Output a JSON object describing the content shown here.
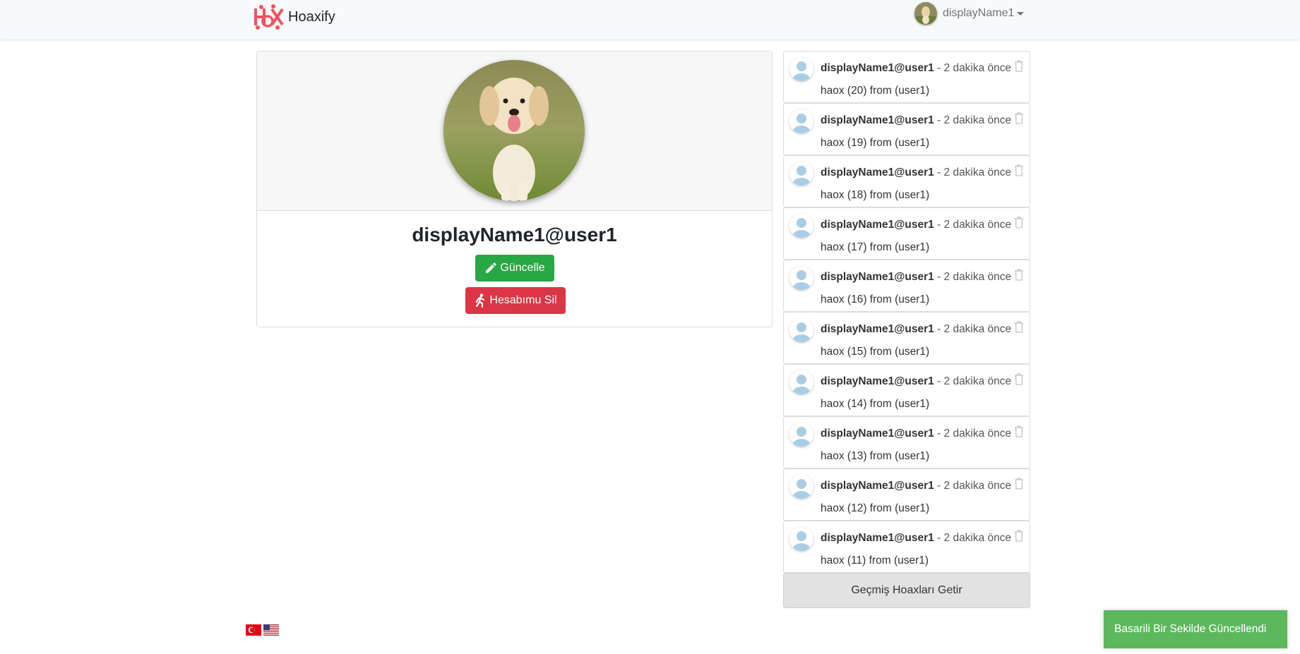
{
  "navbar": {
    "brand": "Hoaxify",
    "user_display_name": "displayName1"
  },
  "profile": {
    "title": "displayName1@user1",
    "update_label": "Güncelle",
    "delete_label": "Hesabımu Sil"
  },
  "hoaxes": [
    {
      "user": "displayName1@user1",
      "separator": " - ",
      "time": "2 dakika önce",
      "content": "haox (20) from (user1)"
    },
    {
      "user": "displayName1@user1",
      "separator": " - ",
      "time": "2 dakika önce",
      "content": "haox (19) from (user1)"
    },
    {
      "user": "displayName1@user1",
      "separator": " - ",
      "time": "2 dakika önce",
      "content": "haox (18) from (user1)"
    },
    {
      "user": "displayName1@user1",
      "separator": " - ",
      "time": "2 dakika önce",
      "content": "haox (17) from (user1)"
    },
    {
      "user": "displayName1@user1",
      "separator": " - ",
      "time": "2 dakika önce",
      "content": "haox (16) from (user1)"
    },
    {
      "user": "displayName1@user1",
      "separator": " - ",
      "time": "2 dakika önce",
      "content": "haox (15) from (user1)"
    },
    {
      "user": "displayName1@user1",
      "separator": " - ",
      "time": "2 dakika önce",
      "content": "haox (14) from (user1)"
    },
    {
      "user": "displayName1@user1",
      "separator": " - ",
      "time": "2 dakika önce",
      "content": "haox (13) from (user1)"
    },
    {
      "user": "displayName1@user1",
      "separator": " - ",
      "time": "2 dakika önce",
      "content": "haox (12) from (user1)"
    },
    {
      "user": "displayName1@user1",
      "separator": " - ",
      "time": "2 dakika önce",
      "content": "haox (11) from (user1)"
    }
  ],
  "load_more_label": "Geçmiş Hoaxları Getir",
  "toast": "Basarili Bir Sekilde Güncellendi",
  "colors": {
    "success": "#28a745",
    "danger": "#dc3545",
    "toast": "#5cb85c",
    "logo": "#f0525e"
  },
  "icons": {
    "brand": "hoaxify-logo",
    "update": "pencil-icon",
    "delete": "running-person-icon",
    "hoax_delete": "trash-icon",
    "language_tr": "turkey-flag-icon",
    "language_en": "usa-flag-icon"
  }
}
